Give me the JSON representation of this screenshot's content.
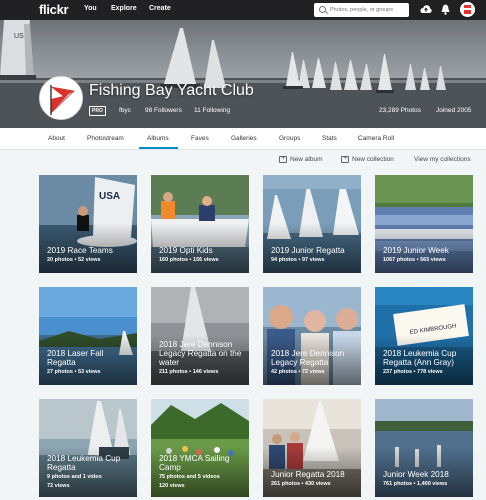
{
  "topnav": {
    "logo": "flickr",
    "links": [
      "You",
      "Explore",
      "Create"
    ],
    "search_placeholder": "Photos, people, or groups"
  },
  "profile": {
    "name": "Fishing Bay Yacht Club",
    "pro_badge": "PRO",
    "username": "fbyc",
    "followers": "98 Followers",
    "following": "11 Following",
    "photos": "23,289 Photos",
    "joined": "Joined 2005"
  },
  "tabs": [
    "About",
    "Photostream",
    "Albums",
    "Faves",
    "Galleries",
    "Groups",
    "Stats",
    "Camera Roll"
  ],
  "active_tab": "Albums",
  "actions": {
    "new_album": "New album",
    "new_collection": "New collection",
    "view_collections": "View my collections"
  },
  "albums": [
    {
      "title": "2019 Race Teams",
      "stats": "20 photos  •  52 views"
    },
    {
      "title": "2019 Opti Kids",
      "stats": "160 photos  •  156 views"
    },
    {
      "title": "2019 Junior Regatta",
      "stats": "94 photos  •  97 views"
    },
    {
      "title": "2019 Junior Week",
      "stats": "1067 photos  •  565 views"
    },
    {
      "title": "2018 Laser Fall Regatta",
      "stats": "27 photos  •  53 views"
    },
    {
      "title": "2018 Jere Dennison Legacy Regatta on the water",
      "stats": "211 photos  •  146 views"
    },
    {
      "title": "2018 Jere Dennison Legacy Regatta",
      "stats": "42 photos  •  72 views"
    },
    {
      "title": "2018 Leukemia Cup Regatta (Ann Gray)",
      "stats": "237 photos  •  778 views"
    },
    {
      "title": "2018 Leukemia Cup Regatta",
      "stats": "9 photos and 1 video",
      "stats2": "72 views"
    },
    {
      "title": "2018 YMCA Sailing Camp",
      "stats": "75 photos and 5 videos",
      "stats2": "120 views"
    },
    {
      "title": "Junior Regatta 2018",
      "stats": "261 photos  •  430 views"
    },
    {
      "title": "Junior Week 2018",
      "stats": "761 photos  •  1,400 views"
    }
  ],
  "colors": {
    "nav_bg": "#212124",
    "accent": "#008ecf",
    "page_bg": "#f2f5f6"
  }
}
